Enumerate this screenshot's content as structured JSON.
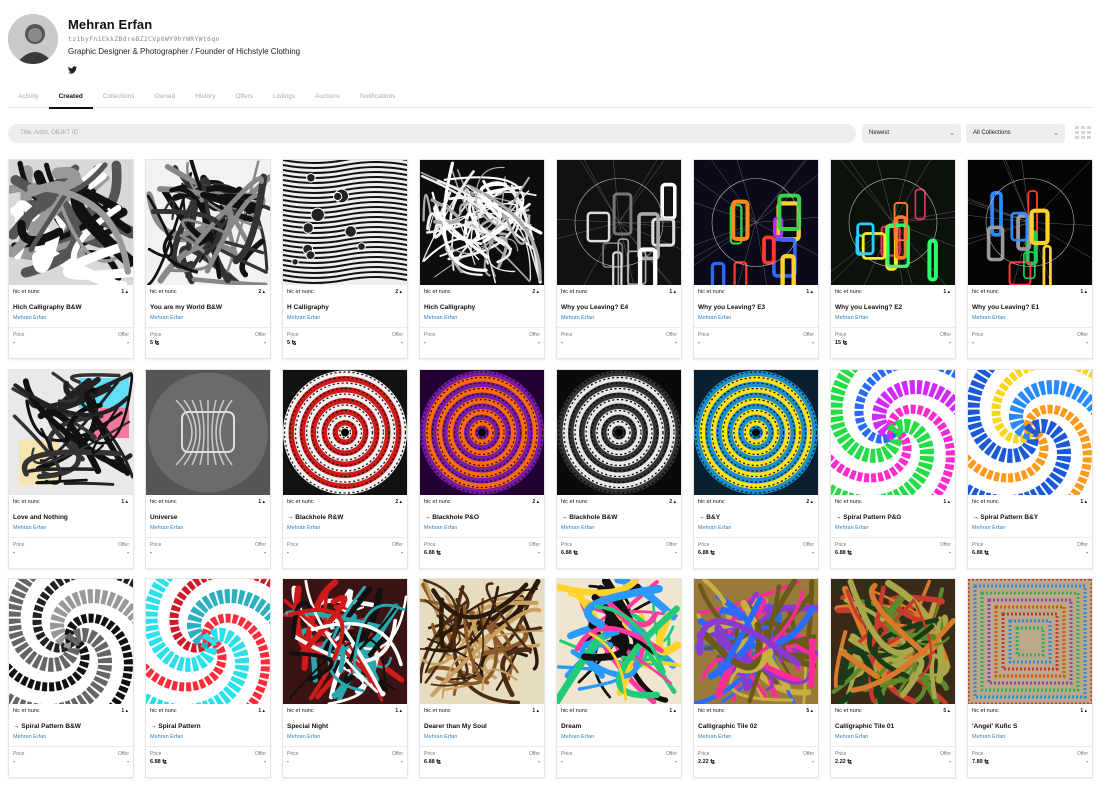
{
  "profile": {
    "name": "Mehran Erfan",
    "address": "tz1byFn1EkkZBdreBZ2CVp6WY9hYWRYWt6qn",
    "bio": "Graphic Designer & Photographer / Founder of Hichstyle Clothing",
    "social_icon": "twitter-icon"
  },
  "tabs": [
    {
      "label": "Activity"
    },
    {
      "label": "Created",
      "active": true
    },
    {
      "label": "Collections"
    },
    {
      "label": "Owned"
    },
    {
      "label": "History"
    },
    {
      "label": "Offers"
    },
    {
      "label": "Listings"
    },
    {
      "label": "Auctions"
    },
    {
      "label": "Notifications"
    }
  ],
  "filters": {
    "search_placeholder": "Title, Artist, OBJKT ID",
    "sort_value": "Newest",
    "collection_value": "All Collections",
    "view_icon": "grid-view-icon"
  },
  "labels": {
    "price": "Price",
    "offer": "Offer"
  },
  "cards": [
    {
      "platform": "hic et nunc",
      "edition": "1 ▴",
      "title": "Hich Calligraphy B&W",
      "creator": "Mehran Erfan",
      "price": "-",
      "offer": "-",
      "art": "bwfloral"
    },
    {
      "platform": "hic et nunc",
      "edition": "2 ▴",
      "title": "You are my World B&W",
      "creator": "Mehran Erfan",
      "price": "5 ꜩ",
      "offer": "-",
      "art": "bwstroke"
    },
    {
      "platform": "hic et nunc",
      "edition": "2 ▴",
      "title": "H Calligraphy",
      "creator": "Mehran Erfan",
      "price": "5 ꜩ",
      "offer": "-",
      "art": "bwstripes"
    },
    {
      "platform": "hic et nunc",
      "edition": "2 ▴",
      "title": "Hich Calligraphy",
      "creator": "Mehran Erfan",
      "price": "-",
      "offer": "-",
      "art": "bwlace"
    },
    {
      "platform": "hic et nunc",
      "edition": "1 ▴",
      "title": "Why you Leaving? E4",
      "creator": "Mehran Erfan",
      "price": "-",
      "offer": "-",
      "art": "leaving_gray"
    },
    {
      "platform": "hic et nunc",
      "edition": "1 ▴",
      "title": "Why you Leaving? E3",
      "creator": "Mehran Erfan",
      "price": "-",
      "offer": "-",
      "art": "leaving_rainbow"
    },
    {
      "platform": "hic et nunc",
      "edition": "1 ▴",
      "title": "Why you Leaving? E2",
      "creator": "Mehran Erfan",
      "price": "15 ꜩ",
      "offer": "-",
      "art": "leaving_neon"
    },
    {
      "platform": "hic et nunc",
      "edition": "1 ▴",
      "title": "Why you Leaving? E1",
      "creator": "Mehran Erfan",
      "price": "-",
      "offer": "-",
      "art": "leaving_dark"
    },
    {
      "platform": "hic et nunc",
      "edition": "1 ▴",
      "title": "Love and Nothing",
      "creator": "Mehran Erfan",
      "price": "-",
      "offer": "-",
      "art": "love"
    },
    {
      "platform": "hic et nunc",
      "edition": "1 ▴",
      "title": "Universe",
      "creator": "Mehran Erfan",
      "price": "-",
      "offer": "-",
      "art": "universe"
    },
    {
      "platform": "hic et nunc",
      "edition": "2 ▴",
      "title": "→ Blackhole R&W",
      "creator": "Mehran Erfan",
      "price": "-",
      "offer": "-",
      "art": "hole_rw"
    },
    {
      "platform": "hic et nunc",
      "edition": "2 ▴",
      "title": "→ Blackhole P&O",
      "creator": "Mehran Erfan",
      "price": "6.88 ꜩ",
      "offer": "-",
      "art": "hole_po"
    },
    {
      "platform": "hic et nunc",
      "edition": "2 ▴",
      "title": "→ Blackhole B&W",
      "creator": "Mehran Erfan",
      "price": "6.88 ꜩ",
      "offer": "-",
      "art": "hole_bw"
    },
    {
      "platform": "hic et nunc",
      "edition": "2 ▴",
      "title": "→ B&Y",
      "creator": "Mehran Erfan",
      "price": "6.88 ꜩ",
      "offer": "-",
      "art": "hole_by"
    },
    {
      "platform": "hic et nunc",
      "edition": "1 ▴",
      "title": "→ Spiral Pattern P&G",
      "creator": "Mehran Erfan",
      "price": "6.88 ꜩ",
      "offer": "-",
      "art": "spiral_pg"
    },
    {
      "platform": "hic et nunc",
      "edition": "1 ▴",
      "title": "→ Spiral Pattern B&Y",
      "creator": "Mehran Erfan",
      "price": "6.88 ꜩ",
      "offer": "-",
      "art": "spiral_by"
    },
    {
      "platform": "hic et nunc",
      "edition": "1 ▴",
      "title": "→ Spiral Pattern B&W",
      "creator": "Mehran Erfan",
      "price": "-",
      "offer": "-",
      "art": "spiral_bw"
    },
    {
      "platform": "hic et nunc",
      "edition": "1 ▴",
      "title": "→ Spiral Pattern",
      "creator": "Mehran Erfan",
      "price": "6.88 ꜩ",
      "offer": "-",
      "art": "spiral_rc"
    },
    {
      "platform": "hic et nunc",
      "edition": "1 ▴",
      "title": "Special Night",
      "creator": "Mehran Erfan",
      "price": "-",
      "offer": "-",
      "art": "night"
    },
    {
      "platform": "hic et nunc",
      "edition": "1 ▴",
      "title": "Dearer than My Soul",
      "creator": "Mehran Erfan",
      "price": "6.88 ꜩ",
      "offer": "-",
      "art": "dearer"
    },
    {
      "platform": "hic et nunc",
      "edition": "1 ▴",
      "title": "Dream",
      "creator": "Mehran Erfan",
      "price": "-",
      "offer": "-",
      "art": "dream"
    },
    {
      "platform": "hic et nunc",
      "edition": "5 ▴",
      "title": "Calligraphic Tile 02",
      "creator": "Mehran Erfan",
      "price": "2.22 ꜩ",
      "offer": "-",
      "art": "tile2"
    },
    {
      "platform": "hic et nunc",
      "edition": "5 ▴",
      "title": "Calligraphic Tile 01",
      "creator": "Mehran Erfan",
      "price": "2.22 ꜩ",
      "offer": "-",
      "art": "tile1"
    },
    {
      "platform": "hic et nunc",
      "edition": "1 ▴",
      "title": "'Angel' Kufic S",
      "creator": "Mehran Erfan",
      "price": "7.89 ꜩ",
      "offer": "-",
      "art": "angel"
    }
  ]
}
